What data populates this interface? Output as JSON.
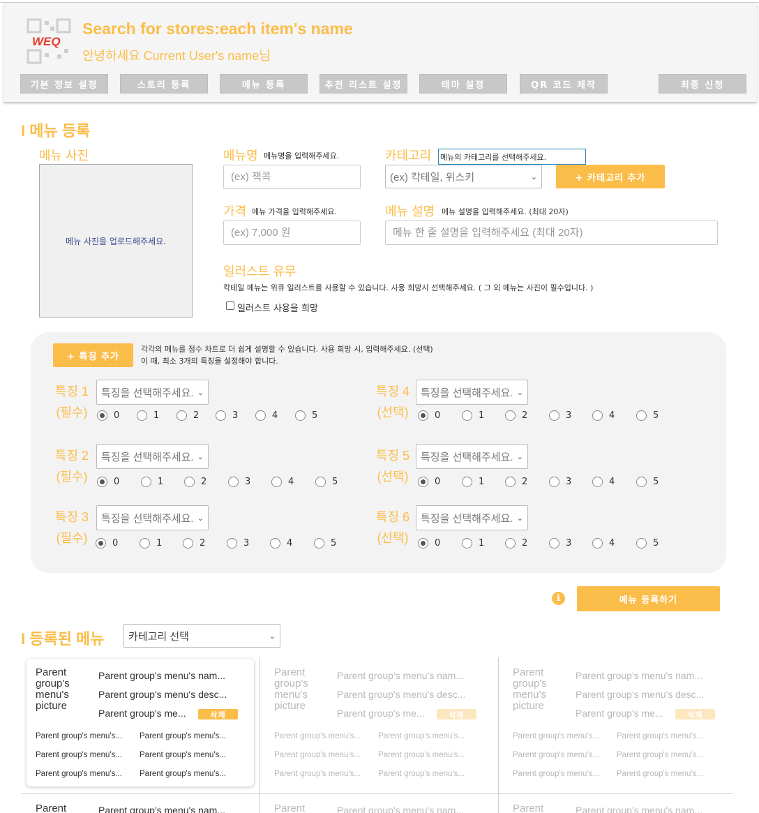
{
  "header": {
    "logo_text": "WEQ",
    "title": "Search for stores:each item's name",
    "greeting": "안녕하세요 Current User's name님",
    "nav": [
      "기본 정보 설정",
      "스토리 등록",
      "메뉴 등록",
      "추천 리스트 설정",
      "테마 설정",
      "QR 코드 제작",
      "최종 신청"
    ]
  },
  "menu_register": {
    "section_title": "I 메뉴 등록",
    "photo_label": "메뉴 사진",
    "photo_placeholder": "메뉴 사진을 업로드해주세요.",
    "name_label": "메뉴명",
    "name_hint": "메뉴명을 입력해주세요.",
    "name_placeholder": "(ex) 잭콕",
    "category_label": "카테고리",
    "category_hint": "메뉴의 카테고리를 선택해주세요.",
    "category_placeholder": "(ex) 칵테일, 위스키",
    "add_category": "+ 카테고리 추가",
    "price_label": "가격",
    "price_hint": "메뉴 가격을 입력해주세요.",
    "price_placeholder": "(ex) 7,000 원",
    "desc_label": "메뉴 설명",
    "desc_hint": "메뉴 설명을 입력해주세요. (최대 20자)",
    "desc_placeholder": "메뉴 한 줄 설명을 입력해주세요 (최대 20자)",
    "illust_label": "일러스트 유무",
    "illust_hint": "칵테일 메뉴는 위큐 일러스트를 사용할 수 있습니다. 사용 희망시 선택해주세요. ( 그 외 메뉴는 사진이 필수입니다. )",
    "illust_checkbox": "일러스트 사용을 희망"
  },
  "traits": {
    "add_button": "+ 특징 추가",
    "desc_line1": "각각의 메뉴를 점수 차트로 더 쉽게 설명할 수 있습니다. 사용 희망 시, 입력해주세요. (선택)",
    "desc_line2": "이 때, 최소 3개의 특징을 설정해야 합니다.",
    "select_placeholder": "특징을 선택해주세요.",
    "scores": [
      "0",
      "1",
      "2",
      "3",
      "4",
      "5"
    ],
    "items": [
      {
        "name": "특징 1",
        "req": "(필수)",
        "selected": 0
      },
      {
        "name": "특징 2",
        "req": "(필수)",
        "selected": 0
      },
      {
        "name": "특징 3",
        "req": "(필수)",
        "selected": 0
      },
      {
        "name": "특징 4",
        "req": "(선택)",
        "selected": 0
      },
      {
        "name": "특징 5",
        "req": "(선택)",
        "selected": 0
      },
      {
        "name": "특징 6",
        "req": "(선택)",
        "selected": 0
      }
    ]
  },
  "submit_button": "메뉴 등록하기",
  "registered": {
    "section_title": "I 등록된 메뉴",
    "category_select": "카테고리 선택",
    "card": {
      "picture": "Parent group's menu's picture",
      "name": "Parent group's menu's nam...",
      "desc": "Parent group's menu's desc...",
      "third": "Parent group's me...",
      "delete": "삭제",
      "sub": "Parent group's menu's..."
    }
  }
}
